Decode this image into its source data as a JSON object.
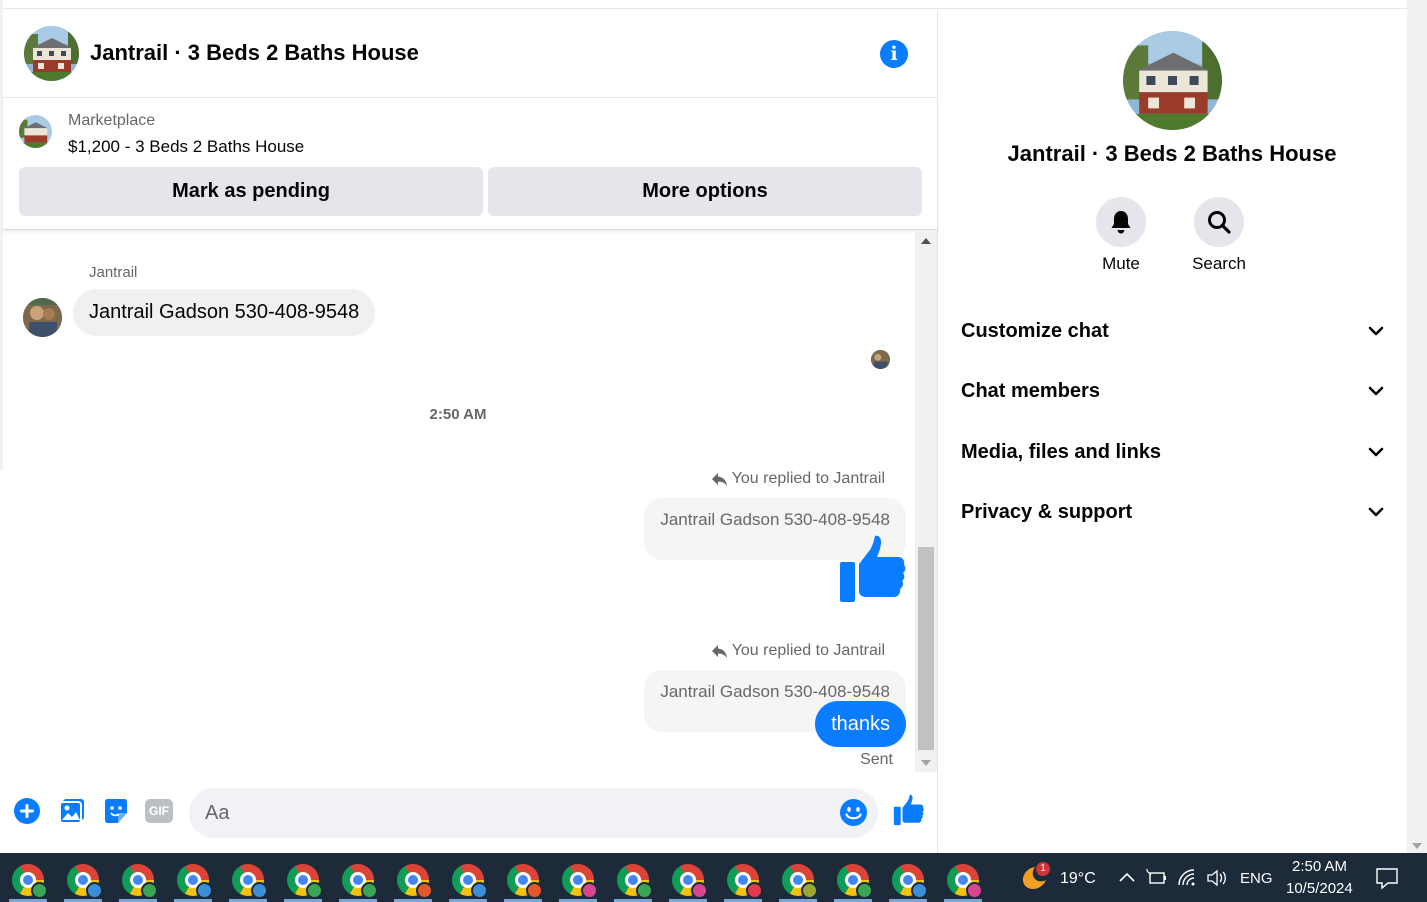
{
  "chat": {
    "title": "Jantrail · 3 Beds 2 Baths House",
    "marketplace": {
      "label": "Marketplace",
      "item": "$1,200 - 3 Beds 2 Baths House",
      "mark_pending_label": "Mark as pending",
      "more_options_label": "More options"
    },
    "messages": {
      "sender_name": "Jantrail",
      "incoming_text": "Jantrail Gadson 530-408-9548",
      "timestamp": "2:50 AM",
      "reply1": {
        "label": "You replied to Jantrail",
        "quoted": "Jantrail Gadson 530-408-9548"
      },
      "reply2": {
        "label": "You replied to Jantrail",
        "quoted": "Jantrail Gadson 530-408-9548",
        "text": "thanks"
      },
      "status": "Sent"
    },
    "composer": {
      "placeholder": "Aa",
      "gif_label": "GIF"
    },
    "accent_color": "#0a7cff"
  },
  "info_panel": {
    "title": "Jantrail · 3 Beds 2 Baths House",
    "actions": [
      {
        "label": "Mute",
        "icon": "bell-icon"
      },
      {
        "label": "Search",
        "icon": "search-icon"
      }
    ],
    "sections": [
      {
        "label": "Customize chat"
      },
      {
        "label": "Chat members"
      },
      {
        "label": "Media, files and links"
      },
      {
        "label": "Privacy & support"
      }
    ]
  },
  "taskbar": {
    "weather_badge": "1",
    "temperature": "19°C",
    "language": "ENG",
    "time": "2:50 AM",
    "date": "10/5/2024",
    "chrome_profile_badge_colors": [
      "#3aa655",
      "#3a8fd8",
      "#3aa655",
      "#3a8fd8",
      "#3a8fd8",
      "#3aa655",
      "#3aa655",
      "#e2572c",
      "#3a8fd8",
      "#e2572c",
      "#d9468f",
      "#3aa655",
      "#d9468f",
      "#e23a4a",
      "#9aa634",
      "#3aa655",
      "#3a8fd8",
      "#d9468f"
    ]
  }
}
